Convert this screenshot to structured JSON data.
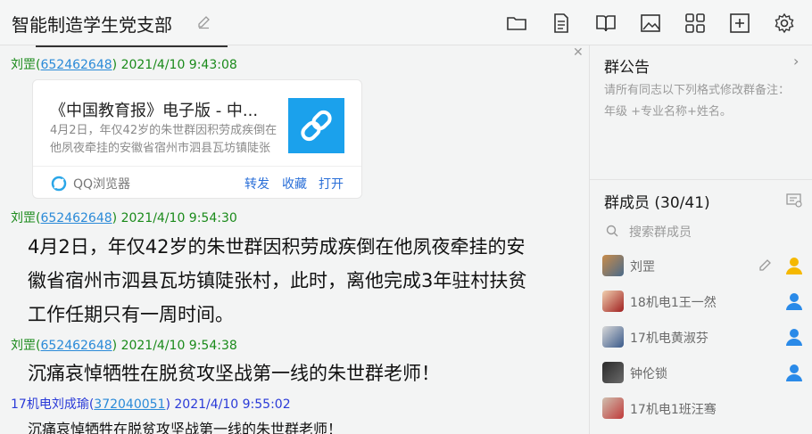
{
  "header": {
    "title": "智能制造学生党支部",
    "toolbar_icons": [
      "folder-icon",
      "document-icon",
      "book-icon",
      "image-icon",
      "apps-grid-icon",
      "add-window-icon",
      "settings-icon"
    ]
  },
  "chat": {
    "messages": [
      {
        "sender_name": "刘罡",
        "sender_id": "652462648",
        "time": "2021/4/10 9:43:08",
        "card": {
          "title": "《中国教育报》电子版 - 中...",
          "description": "4月2日，年仅42岁的朱世群因积劳成疾倒在他夙夜牵挂的安徽省宿州市泗县瓦坊镇陡张",
          "source": "QQ浏览器",
          "actions": [
            "转发",
            "收藏",
            "打开"
          ]
        }
      },
      {
        "sender_name": "刘罡",
        "sender_id": "652462648",
        "time": "2021/4/10 9:54:30",
        "text_lines": [
          "4月2日，年仅42岁的朱世群因积劳成疾倒在他夙夜牵挂的安",
          "徽省宿州市泗县瓦坊镇陡张村，此时，离他完成3年驻村扶贫",
          "工作任期只有一周时间。"
        ]
      },
      {
        "sender_name": "刘罡",
        "sender_id": "652462648",
        "time": "2021/4/10 9:54:38",
        "text": "沉痛哀悼牺牲在脱贫攻坚战第一线的朱世群老师！"
      },
      {
        "sender_name": "17机电刘成瑜",
        "sender_id": "372040051",
        "time": "2021/4/10 9:55:02",
        "text": "沉痛哀悼牺牲在脱贫攻坚战第一线的朱世群老师！"
      }
    ]
  },
  "sidebar": {
    "notice_title": "群公告",
    "notice_text": "请所有同志以下列格式修改群备注：年级 +专业名称+姓名。",
    "members_title": "群成员 (30/41)",
    "search_placeholder": "搜索群成员",
    "members": [
      {
        "name": "刘罡",
        "role": "owner"
      },
      {
        "name": "18机电1王一然",
        "role": "admin"
      },
      {
        "name": "17机电黄淑芬",
        "role": "admin"
      },
      {
        "name": "钟伦锁",
        "role": "admin"
      },
      {
        "name": "17机电1班汪骞",
        "role": "member"
      }
    ]
  },
  "colors": {
    "owner_badge": "#f5b800",
    "admin_badge": "#2a8ae8",
    "link": "#2a6fd8",
    "sender_green": "#1a8a1a",
    "sender_blue": "#2a3ad8",
    "card_thumb": "#1ba1ec"
  }
}
